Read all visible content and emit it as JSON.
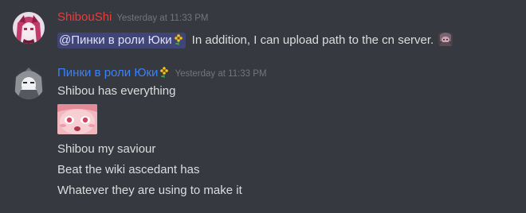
{
  "messages": [
    {
      "username": "ShibouShi",
      "timestamp": "Yesterday at 11:33 PM",
      "mention": "@Пинки в роли Юки",
      "text": "In addition, I can upload path to the cn server.",
      "avatar_icon": "pink-hair-character-avatar",
      "emoji_icon": "hooded-character-emoji",
      "color": "#e73d3d"
    },
    {
      "username": "Пинки в роли Юки",
      "timestamp": "Yesterday at 11:33 PM",
      "lines": [
        "Shibou has everything",
        "Shibou my saviour",
        "Beat the wiki ascedant has",
        "Whatever they are using to make it"
      ],
      "avatar_icon": "grey-hooded-character-avatar",
      "emoji_icon": "pink-anime-face-emoji",
      "color": "#3b82f6"
    }
  ],
  "colors": {
    "background": "#36393f",
    "text": "#dcddde",
    "timestamp": "#72767d",
    "mention_bg": "#414675"
  }
}
